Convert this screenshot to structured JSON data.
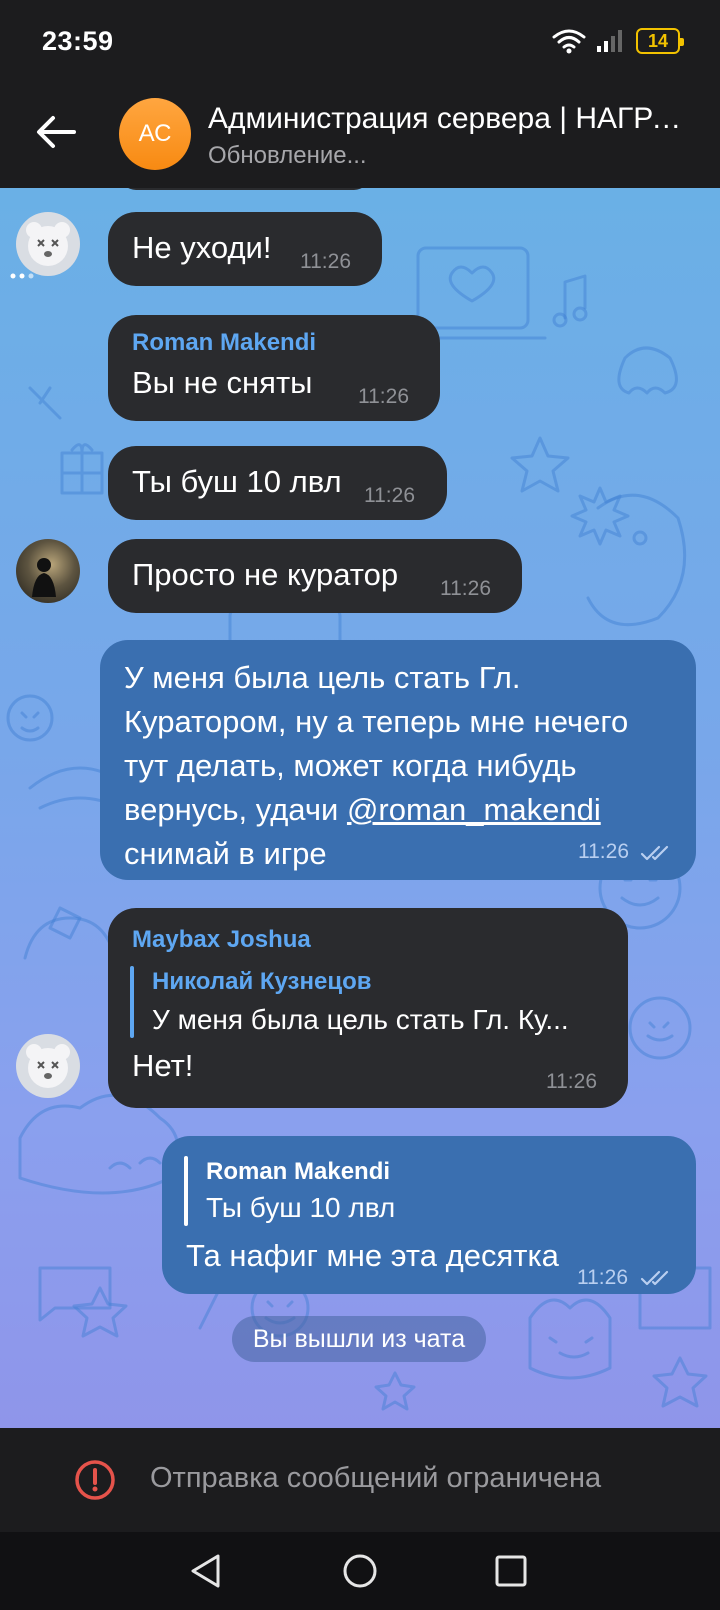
{
  "status_bar": {
    "time": "23:59",
    "battery": "14"
  },
  "header": {
    "avatar_initials": "АС",
    "title": "Администрация сервера | НАГРАДЫ",
    "subtitle": "Обновление..."
  },
  "messages": [
    {
      "text": "Не уходи!",
      "time": "11:26"
    },
    {
      "sender": "Roman Makendi",
      "text": "Вы не сняты",
      "time": "11:26"
    },
    {
      "text": "Ты буш 10 лвл",
      "time": "11:26"
    },
    {
      "text": "Просто не куратор",
      "time": "11:26"
    },
    {
      "line1": "У меня была цель стать Гл.",
      "line2": "Куратором, ну а теперь мне нечего",
      "line3": "тут делать, может когда нибудь",
      "line4_prefix": "вернусь, удачи ",
      "mention": "@roman_makendi",
      "line5": "снимай в игре",
      "time": "11:26"
    },
    {
      "sender": "Maybax Joshua",
      "reply_name": "Николай Кузнецов",
      "reply_text": "У меня была цель стать Гл. Ку...",
      "text": "Нет!",
      "time": "11:26"
    },
    {
      "reply_name": "Roman Makendi",
      "reply_text": "Ты буш 10 лвл",
      "text": "Та нафиг мне эта десятка",
      "time": "11:26"
    }
  ],
  "service_message": "Вы вышли из чата",
  "restriction": {
    "text": "Отправка сообщений ограничена",
    "icon": "warning-icon"
  },
  "colors": {
    "incoming": "#2a2b2e",
    "outgoing": "#3a6fb0",
    "accent_name": "#5ea7f2"
  }
}
